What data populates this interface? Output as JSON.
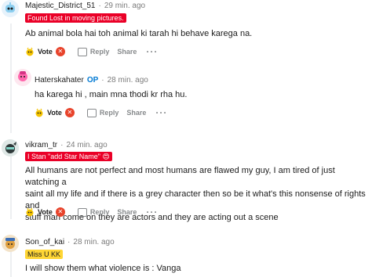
{
  "comments": [
    {
      "author": "Majestic_District_51",
      "time": "29 min. ago",
      "flair": "Found Lost in moving pictures.",
      "text": "Ab animal bola hai toh animal ki tarah hi behave karega na.",
      "vote_label": "Vote",
      "reply_label": "Reply",
      "share_label": "Share"
    },
    {
      "author": "Haterskahater",
      "op_badge": "OP",
      "time": "28 min. ago",
      "text": "ha karega hi , main mna thodi kr rha hu.",
      "vote_label": "Vote",
      "reply_label": "Reply",
      "share_label": "Share"
    },
    {
      "author": "vikram_tr",
      "time": "24 min. ago",
      "flair": "I Stan \"add Star Name\" 😍",
      "text_lines": [
        "All humans are not perfect and most humans are flawed my guy, I am tired of just watching a",
        "saint all my life and if there is a grey character then so be it what's this nonsense of rights and",
        "stuff man come on they are actors and they are acting out a scene"
      ],
      "vote_label": "Vote",
      "reply_label": "Reply",
      "share_label": "Share"
    },
    {
      "author": "Son_of_kai",
      "time": "28 min. ago",
      "flair": "Miss U KK",
      "text": "I will show them what violence is : Vanga"
    }
  ],
  "separator": "·",
  "more_label": "···",
  "colors": {
    "flair_red": "#ea0027",
    "flair_yellow": "#ffd635",
    "op_blue": "#0079d3",
    "downvote_red": "#e8432b"
  },
  "icons": {
    "upvote": "yellow-creature-icon",
    "downvote": "red-x-circle-icon",
    "reply": "speech-bubble-icon"
  }
}
